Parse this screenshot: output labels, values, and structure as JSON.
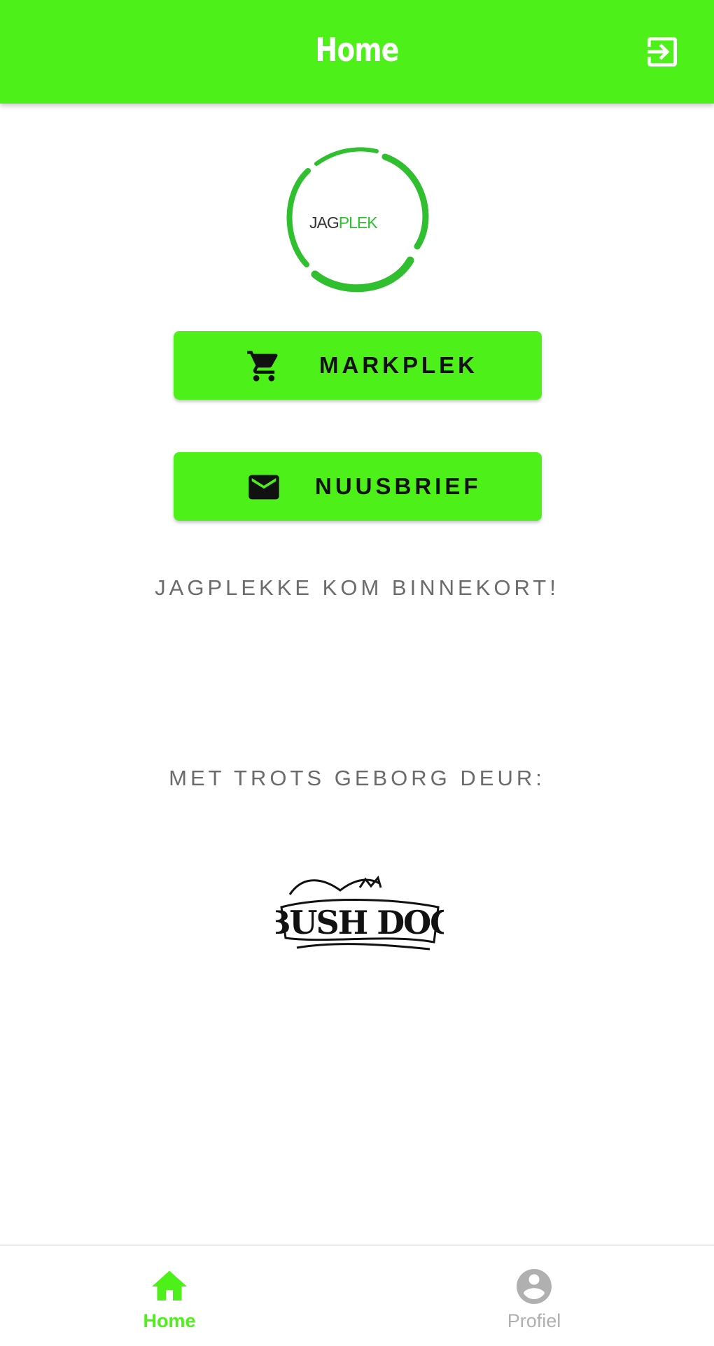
{
  "header": {
    "title": "Home",
    "logout_icon": "login-icon",
    "background": "#4ef01a"
  },
  "logo": {
    "text_part1": "JAG",
    "text_part2": "PLEK",
    "ring_color": "#2fbf2f"
  },
  "actions": {
    "markplek": {
      "label": "MARKPLEK",
      "icon": "shopping-cart-icon"
    },
    "nuusbrief": {
      "label": "NUUSBRIEF",
      "icon": "mail-icon"
    }
  },
  "coming_soon": "JAGPLEKKE KOM BINNEKORT!",
  "sponsor": {
    "label": "MET TROTS GEBORG DEUR:",
    "logo_text": "BUSH DOG"
  },
  "bottom_nav": {
    "items": [
      {
        "label": "Home",
        "icon": "home-icon",
        "active": true,
        "color": "#4ef01a"
      },
      {
        "label": "Profiel",
        "icon": "account-circle-icon",
        "active": false,
        "color": "#b0b0b0"
      }
    ]
  }
}
